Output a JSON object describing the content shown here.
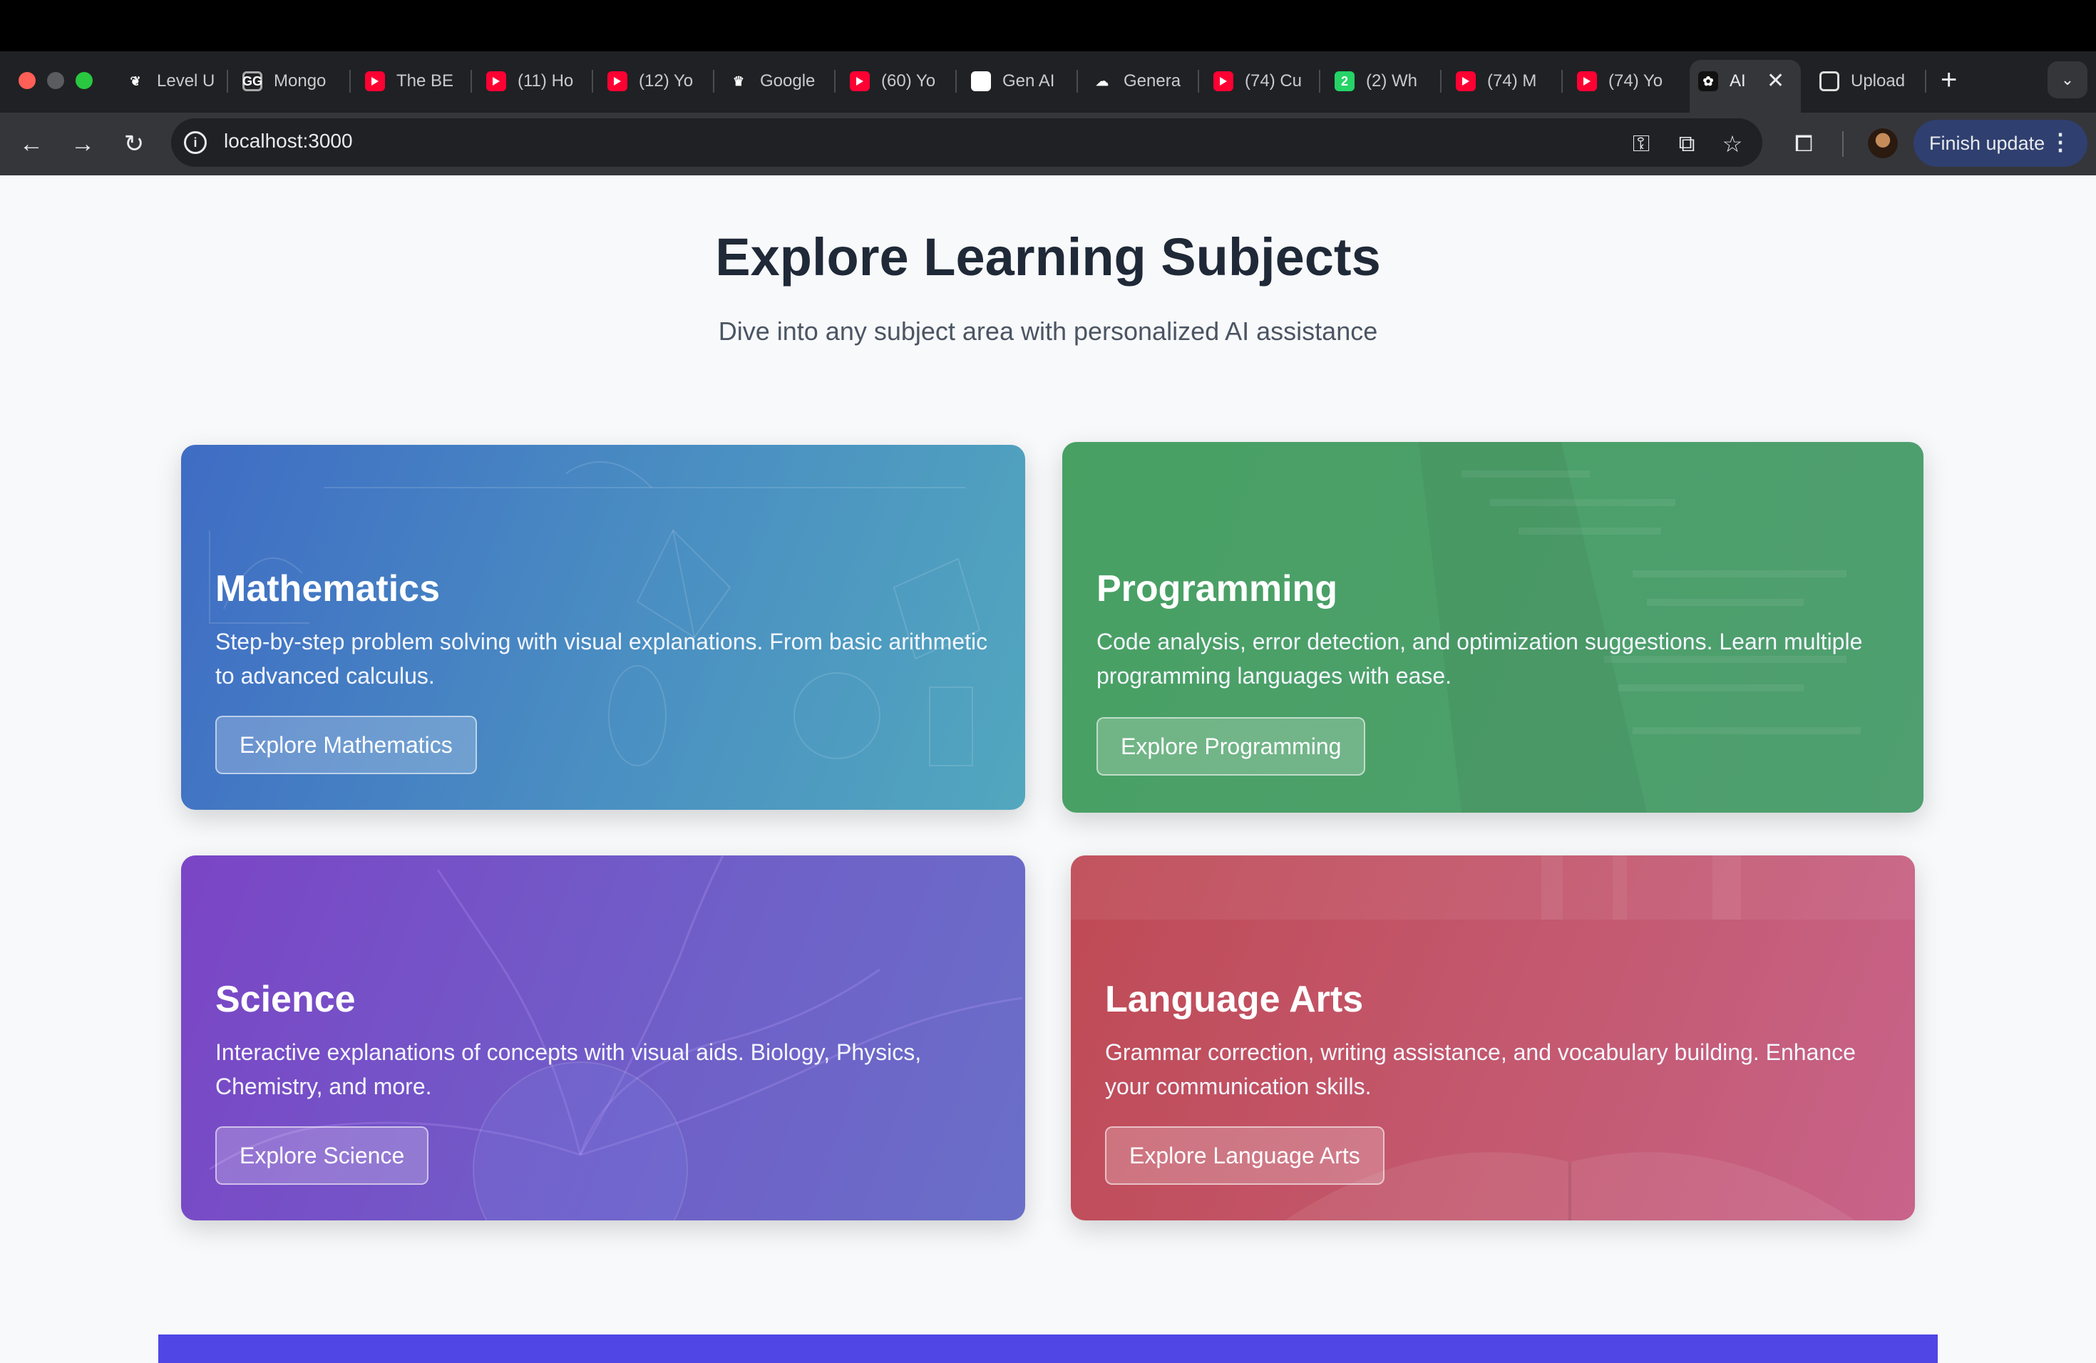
{
  "browser": {
    "tabs": [
      {
        "title": "Level U",
        "icon": "leaf-icon"
      },
      {
        "title": "Mongo",
        "icon": "gfg-icon"
      },
      {
        "title": "The BE",
        "icon": "youtube-icon"
      },
      {
        "title": "(11) Ho",
        "icon": "youtube-icon"
      },
      {
        "title": "(12) Yo",
        "icon": "youtube-icon"
      },
      {
        "title": "Google",
        "icon": "crown-icon"
      },
      {
        "title": "(60) Yo",
        "icon": "youtube-icon"
      },
      {
        "title": "Gen AI",
        "icon": "gen-ai-icon"
      },
      {
        "title": "Genera",
        "icon": "google-cloud-icon"
      },
      {
        "title": "(74) Cu",
        "icon": "youtube-icon"
      },
      {
        "title": "(2) Wh",
        "icon": "whatsapp-icon",
        "badge": "2"
      },
      {
        "title": "(74) M",
        "icon": "youtube-icon"
      },
      {
        "title": "(74) Yo",
        "icon": "youtube-icon"
      },
      {
        "title": "AI",
        "icon": "ai-icon",
        "active": true
      },
      {
        "title": "Upload",
        "icon": "openai-icon"
      }
    ],
    "url": "localhost:3000",
    "update_button": "Finish update"
  },
  "page": {
    "title": "Explore Learning Subjects",
    "subtitle": "Dive into any subject area with personalized AI assistance"
  },
  "cards": [
    {
      "title": "Mathematics",
      "description": "Step-by-step problem solving with visual explanations. From basic arithmetic to advanced calculus.",
      "button": "Explore Mathematics",
      "color": "#4a8fc2"
    },
    {
      "title": "Programming",
      "description": "Code analysis, error detection, and optimization suggestions. Learn multiple programming languages with ease.",
      "button": "Explore Programming",
      "color": "#4c9f6a"
    },
    {
      "title": "Science",
      "description": "Interactive explanations of concepts with visual aids. Biology, Physics, Chemistry, and more.",
      "button": "Explore Science",
      "color": "#7452c6"
    },
    {
      "title": "Language Arts",
      "description": "Grammar correction, writing assistance, and vocabulary building. Enhance your communication skills.",
      "button": "Explore Language Arts",
      "color": "#c45466"
    }
  ],
  "colors": {
    "accent_band": "#4f46e5",
    "page_bg": "#f8f9fb"
  }
}
